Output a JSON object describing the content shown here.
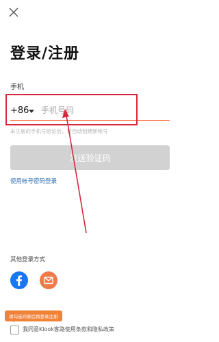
{
  "header": {
    "close_icon": "close-icon",
    "title": "登录/注册"
  },
  "form": {
    "phone_label": "手机",
    "country_code": "+86",
    "phone_placeholder": "手机号码",
    "phone_value": "",
    "hint": "未注册的手机号验证后，将自动创建新帐号",
    "send_code_button": "发送验证码",
    "password_login_link": "使用帐号密码登录"
  },
  "other_login": {
    "label": "其他登录方式",
    "options": [
      {
        "name": "facebook",
        "icon": "facebook-icon",
        "color": "#1877f2"
      },
      {
        "name": "email",
        "icon": "mail-icon",
        "color": "#f07a48"
      }
    ]
  },
  "agreement": {
    "tooltip": "请勾选同意后再登录注册",
    "checked": false,
    "text": "我同意Klook客路使用条款和隐私政策"
  },
  "colors": {
    "accent": "#ff5722",
    "link": "#2b6cb0",
    "button_disabled": "#d2d2d2",
    "annotation": "#d7263d"
  }
}
